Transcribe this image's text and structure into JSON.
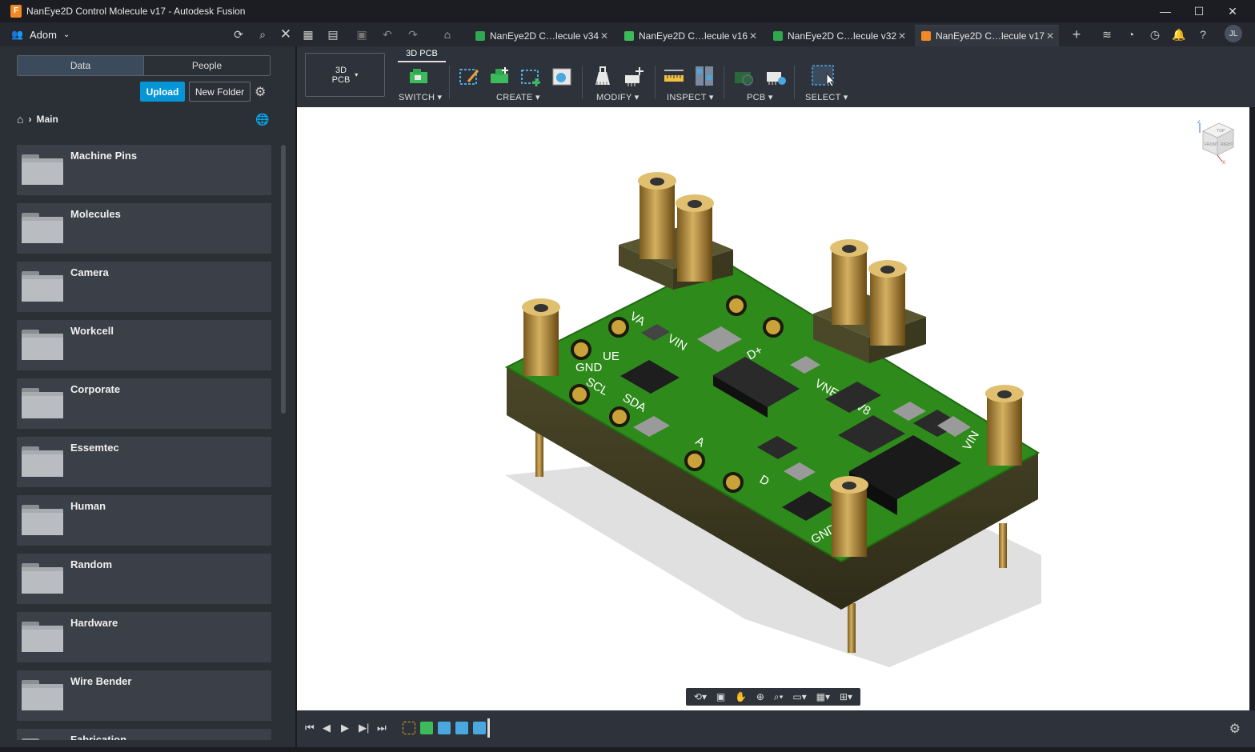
{
  "window": {
    "title": "NanEye2D Control Molecule v17 - Autodesk Fusion",
    "controls": {
      "minimize": "—",
      "maximize": "☐",
      "close": "✕"
    }
  },
  "appbar": {
    "team_name": "Adom",
    "tabs": [
      {
        "label": "NanEye2D C…lecule v34",
        "icon_color": "#2fa84f",
        "close": "✕"
      },
      {
        "label": "NanEye2D C…lecule v16",
        "icon_color": "#3dbb5a",
        "close": "✕"
      },
      {
        "label": "NanEye2D C…lecule v32",
        "icon_color": "#2fa84f",
        "close": "✕"
      },
      {
        "label": "NanEye2D C…lecule v17",
        "icon_color": "#f08a24",
        "close": "✕"
      }
    ],
    "user_initials": "JL"
  },
  "data_panel": {
    "tabs": {
      "data": "Data",
      "people": "People"
    },
    "upload_label": "Upload",
    "new_folder_label": "New Folder",
    "breadcrumb": "Main",
    "folders": [
      "Machine Pins",
      "Molecules",
      "Camera",
      "Workcell",
      "Corporate",
      "Essemtec",
      "Human",
      "Random",
      "Hardware",
      "Wire Bender",
      "Fabrication"
    ]
  },
  "toolbar": {
    "workspace": {
      "line1": "3D",
      "line2": "PCB"
    },
    "active_tab": "3D PCB",
    "groups": {
      "switch": "SWITCH ▾",
      "create": "CREATE ▾",
      "modify": "MODIFY ▾",
      "inspect": "INSPECT ▾",
      "pcb": "PCB ▾",
      "select": "SELECT ▾"
    }
  },
  "viewcube": {
    "top": "TOP",
    "front": "FRONT",
    "right": "RIGHT",
    "axis_z": "Z",
    "axis_x": "X"
  },
  "board": {
    "silk_labels": [
      "VA",
      "VIN",
      "UE",
      "GND",
      "SCL",
      "SDA",
      "D+",
      "VNE",
      "1V8",
      "A",
      "D",
      "GND",
      "VIN"
    ]
  },
  "colors": {
    "accent": "#0696d7",
    "pcb_green": "#2e8a1a",
    "brass": "#b8923a",
    "panel_bg": "#2b2f36",
    "folder_card": "#3a3f48"
  }
}
